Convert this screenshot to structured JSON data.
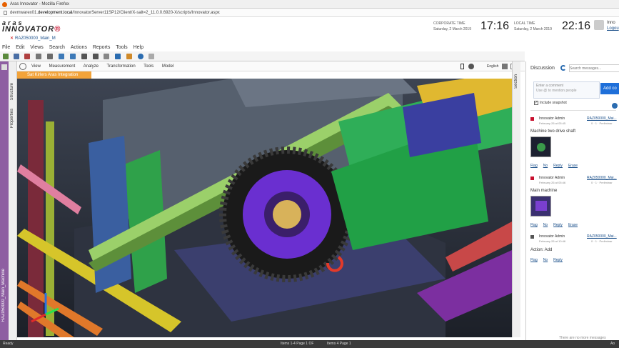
{
  "browser": {
    "window_title": "Aras Innovator - Mozilla Firefox",
    "url_prefix": "devmwarex01.",
    "url_domain": "development.local",
    "url_path": "/InnovatorServer11SP12/Client/X-salt=2_11.0.0.6920-X/scripts/Innovator.aspx"
  },
  "app": {
    "logo_top": "aras",
    "logo_main": "INNOVATOR",
    "logo_mark": "®",
    "open_item_tab": "RAZ050000_Main_M"
  },
  "times": {
    "corporate_label": "CORPORATE TIME",
    "corporate_date": "Saturday, 2 March 2019",
    "corporate_time": "17:16",
    "local_label": "LOCAL TIME",
    "local_date": "Saturday, 2 March 2019",
    "local_time": "22:16",
    "user_name": "Inno",
    "logout": "Logou"
  },
  "menu": [
    "File",
    "Edit",
    "Views",
    "Search",
    "Actions",
    "Reports",
    "Tools",
    "Help"
  ],
  "side_tabs": {
    "structure": "Structure",
    "properties": "Properties",
    "part_name": "RAZ050000_Main_Machine",
    "section": "Section"
  },
  "viewer": {
    "menu": [
      "View",
      "Measurement",
      "Analyze",
      "Transformation",
      "Tools",
      "Model"
    ],
    "language": "English",
    "banner": "Sat Kirlers Aras Integration"
  },
  "discussion": {
    "title": "Discussion",
    "search_placeholder": "Search messages...",
    "comment_placeholder_1": "Enter a comment",
    "comment_placeholder_2": "Use @ to mention people",
    "add_comment": "Add co",
    "include_snapshot": "Include snapshot",
    "posts": [
      {
        "author": "Innovator Admin",
        "date": "February 26 at 05:45",
        "link": "RAZ050000_Mai...",
        "ref": "0 · 1 · Preliminar",
        "text": "Machine two drive shaft",
        "has_image": true
      },
      {
        "author": "Innovator Admin",
        "date": "February 26 at 05:46",
        "link": "RAZ050000_Mai...",
        "ref": "0 · 1 · Preliminar",
        "text": "Main machine",
        "has_image": true
      },
      {
        "author": "Innovator Admin",
        "date": "February 26 at 10:46",
        "link": "RAZ050000_Mai...",
        "ref": "0 · 1 · Preliminar",
        "text": "Action: Add",
        "has_image": false
      }
    ],
    "actions": {
      "flag": "Flag",
      "count": "No",
      "reply": "Reply",
      "erase": "Erase"
    },
    "no_more": "There are no more messages"
  },
  "status": {
    "left": "Ready",
    "center": "Items 1-4 Page 1 OF",
    "center2": "Items 4 Page 1",
    "right": "Ao"
  },
  "colors": {
    "purple_strip": "#8e5ea2",
    "orange_banner": "#f2a33a",
    "link": "#1a4f8a",
    "logo_red": "#c8102e",
    "add_button": "#1e6fd9"
  }
}
